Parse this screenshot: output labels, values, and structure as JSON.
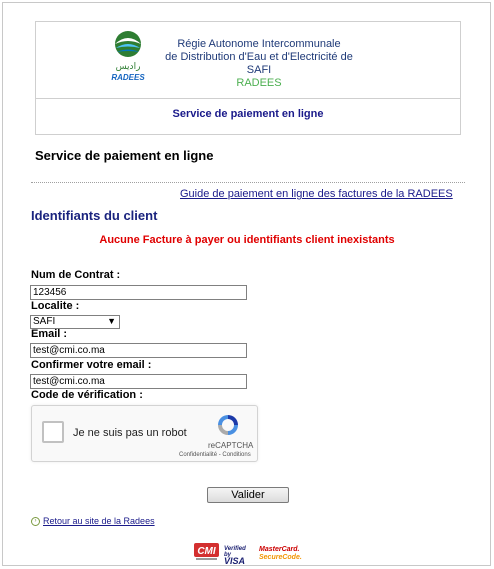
{
  "header": {
    "org_line1": "Régie Autonome Intercommunale",
    "org_line2": "de Distribution d'Eau et d'Electricité de SAFI",
    "org_line3": "RADEES",
    "logo_arabic": "راديس",
    "logo_latin": "RADEES",
    "service": "Service de paiement en ligne"
  },
  "page_title": "Service de paiement en ligne",
  "guide_link": "Guide de paiement en ligne des factures de la RADEES",
  "section_title": "Identifiants du client",
  "error_message": "Aucune Facture à payer ou identifiants client inexistants",
  "form": {
    "contract_label": "Num de Contrat :",
    "contract_value": "123456",
    "localite_label": "Localite :",
    "localite_value": "SAFI",
    "email_label": "Email :",
    "email_value": "test@cmi.co.ma",
    "confirm_label": "Confirmer votre email :",
    "confirm_value": "test@cmi.co.ma",
    "code_label": "Code de vérification :"
  },
  "captcha": {
    "text": "Je ne suis pas un robot",
    "brand": "reCAPTCHA",
    "terms": "Confidentialité - Conditions"
  },
  "submit_label": "Valider",
  "back_link": "Retour au site de la Radees",
  "payment": {
    "cmi": "CMI",
    "visa_top": "Verified by",
    "visa_bottom": "VISA",
    "mc_top": "MasterCard.",
    "mc_bottom": "SecureCode."
  },
  "colors": {
    "accent_blue": "#1a1a8a",
    "error_red": "#e00000",
    "brand_green": "#4caf50"
  }
}
